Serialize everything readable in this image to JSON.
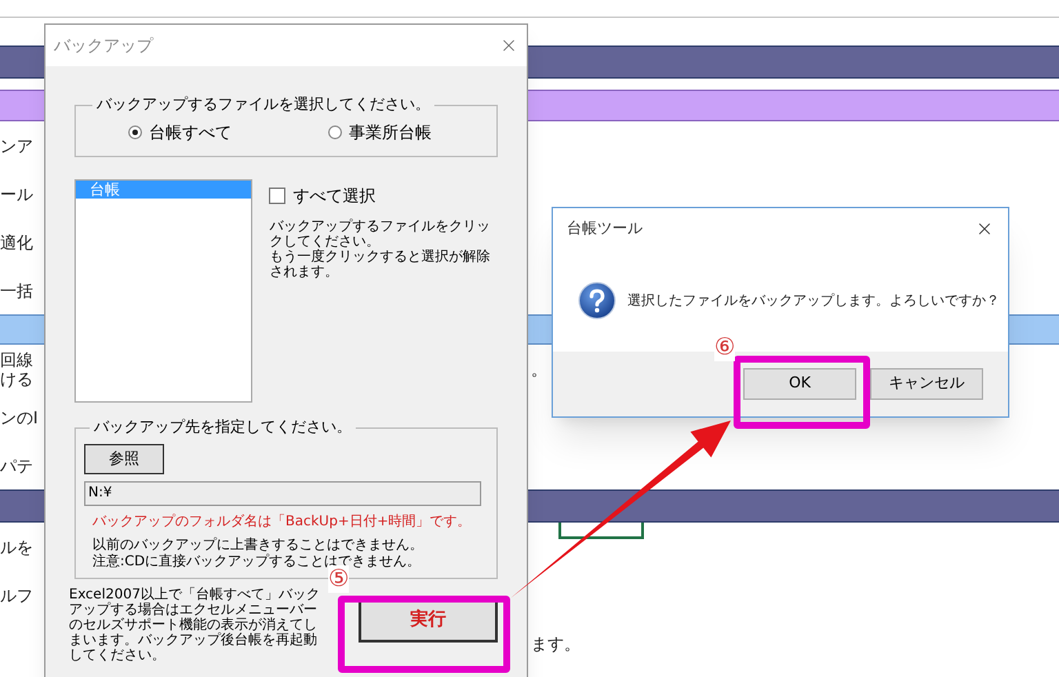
{
  "sheet": {
    "rows": [
      {
        "kind": "dark_band"
      },
      {
        "kind": "light_band"
      },
      {
        "kind": "text",
        "left": [
          "ンア"
        ]
      },
      {
        "kind": "text",
        "left": [
          "ール"
        ]
      },
      {
        "kind": "text",
        "left": [
          "適化"
        ]
      },
      {
        "kind": "text",
        "left": [
          "一括"
        ]
      },
      {
        "kind": "blue_band"
      },
      {
        "kind": "text",
        "left": [
          "回線",
          "ける"
        ],
        "right": "。"
      },
      {
        "kind": "text",
        "left": [
          "ンのI"
        ]
      },
      {
        "kind": "text",
        "left": [
          "パテ"
        ]
      },
      {
        "kind": "dark_band"
      },
      {
        "kind": "text",
        "left": [
          "ルを"
        ],
        "active_cell": true
      },
      {
        "kind": "text",
        "left": [
          "ルフ"
        ]
      },
      {
        "kind": "text",
        "right": "ます。"
      }
    ]
  },
  "backup_dialog": {
    "title": "バックアップ",
    "source_group": {
      "legend": "バックアップするファイルを選択してください。",
      "options": [
        {
          "label": "台帳すべて",
          "selected": true
        },
        {
          "label": "事業所台帳",
          "selected": false
        }
      ]
    },
    "file_list": {
      "items": [
        {
          "label": "台帳",
          "selected": true
        }
      ]
    },
    "select_all": {
      "label": "すべて選択",
      "checked": false
    },
    "hint_lines": [
      "バックアップするファイルをクリックしてください。",
      "もう一度クリックすると選択が解除されます。"
    ],
    "dest_group": {
      "legend": "バックアップ先を指定してください。",
      "browse_button": "参照",
      "path_field": {
        "value": "N:¥"
      },
      "folder_note": "バックアップのフォルダ名は「BackUp+日付+時間」です。",
      "notes": [
        "以前のバックアップに上書きすることはできません。",
        "注意:CDに直接バックアップすることはできません。"
      ]
    },
    "footer_note": "Excel2007以上で「台帳すべて」バックアップする場合はエクセルメニューバーのセルズサポート機能の表示が消えてしまいます。バックアップ後台帳を再起動してください。",
    "run_button": "実行",
    "step": "⑤"
  },
  "confirm_dialog": {
    "title": "台帳ツール",
    "message": "選択したファイルをバックアップします。よろしいですか？",
    "buttons": [
      {
        "label": "OK"
      },
      {
        "label": "キャンセル"
      }
    ],
    "step": "⑥"
  }
}
